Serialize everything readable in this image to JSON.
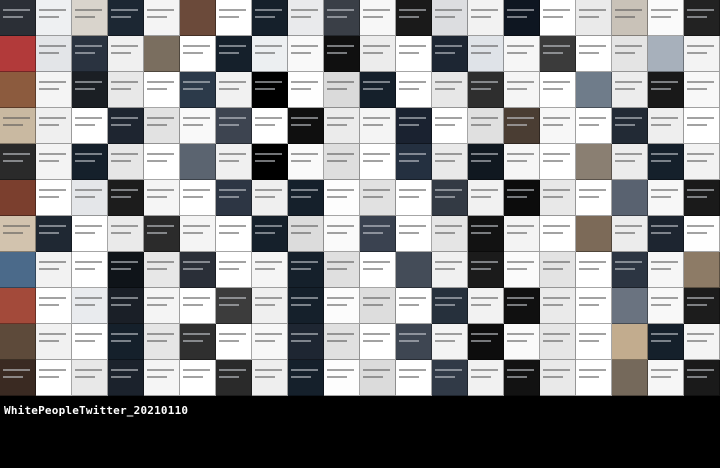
{
  "caption": "WhitePeopleTwitter_20210110",
  "tile_colors": [
    "#2b2f36",
    "#eef0f2",
    "#d9d4cc",
    "#1c2733",
    "#f4f4f4",
    "#6b4a3a",
    "#ffffff",
    "#15202b",
    "#e9eaec",
    "#3a3f47",
    "#f7f7f7",
    "#1a1a1a",
    "#dcdde0",
    "#f2f2f2",
    "#0e1621",
    "#ffffff",
    "#eaeaea",
    "#c9c2b8",
    "#fafafa",
    "#222",
    "#b23a3a",
    "#e3e5e8",
    "#2a3340",
    "#f0f0f0",
    "#7a6e5f",
    "#ffffff",
    "#15202b",
    "#eceff1",
    "#f9f9f9",
    "#101010",
    "#ececec",
    "#ffffff",
    "#1d2633",
    "#dfe3e8",
    "#f6f6f6",
    "#3b3b3b",
    "#ffffff",
    "#e4e4e4",
    "#a7b0bb",
    "#f3f3f3",
    "#8c5b3e",
    "#f4f4f4",
    "#1b1f24",
    "#e8e8e8",
    "#ffffff",
    "#2c3a4a",
    "#f1f1f1",
    "#000000",
    "#fefefe",
    "#dadada",
    "#15202b",
    "#ffffff",
    "#e7e7e7",
    "#2e2e2e",
    "#f5f5f5",
    "#ffffff",
    "#6f7c8a",
    "#ececec",
    "#191919",
    "#f8f8f8",
    "#c9b9a1",
    "#efefef",
    "#ffffff",
    "#1e2530",
    "#e2e2e2",
    "#f9f9f9",
    "#3d4450",
    "#ffffff",
    "#0f0f0f",
    "#ebebeb",
    "#f4f4f4",
    "#1a2230",
    "#ffffff",
    "#e0e0e0",
    "#4a3d33",
    "#f7f7f7",
    "#ffffff",
    "#222a35",
    "#eeeeee",
    "#ffffff",
    "#2a2a2a",
    "#f3f3f3",
    "#15202b",
    "#e6e6e6",
    "#ffffff",
    "#5b6470",
    "#f0f0f0",
    "#000000",
    "#fafafa",
    "#dedede",
    "#ffffff",
    "#243040",
    "#e9e9e9",
    "#101820",
    "#f6f6f6",
    "#ffffff",
    "#8a7f72",
    "#ececec",
    "#15202b",
    "#f2f2f2",
    "#7b3f2e",
    "#ffffff",
    "#e4e6e9",
    "#1c1c1c",
    "#f5f5f5",
    "#ffffff",
    "#2d3644",
    "#efefef",
    "#15202b",
    "#fdfdfd",
    "#e1e1e1",
    "#ffffff",
    "#333a44",
    "#f1f1f1",
    "#0c0c0c",
    "#e8e8e8",
    "#ffffff",
    "#596270",
    "#f7f7f7",
    "#1a1a1a",
    "#d2c3ae",
    "#1f2833",
    "#ffffff",
    "#eaeaea",
    "#2b2b2b",
    "#f4f4f4",
    "#ffffff",
    "#15202b",
    "#dcdcdc",
    "#fafafa",
    "#3a4250",
    "#ffffff",
    "#e5e5e5",
    "#121212",
    "#f3f3f3",
    "#ffffff",
    "#7c6a58",
    "#ececec",
    "#1d2530",
    "#fefefe",
    "#4b6a8a",
    "#f2f2f2",
    "#ffffff",
    "#0f1419",
    "#e7e7e7",
    "#2a2f38",
    "#ffffff",
    "#f5f5f5",
    "#15202b",
    "#dfdfdf",
    "#ffffff",
    "#444c58",
    "#f0f0f0",
    "#1b1b1b",
    "#fbfbfb",
    "#e3e3e3",
    "#ffffff",
    "#2c3542",
    "#f6f6f6",
    "#8d7b66",
    "#a34a3a",
    "#ffffff",
    "#e9ebee",
    "#1a1f27",
    "#f4f4f4",
    "#ffffff",
    "#3c3c3c",
    "#efefef",
    "#15202b",
    "#fcfcfc",
    "#dddddd",
    "#ffffff",
    "#26303c",
    "#f2f2f2",
    "#101010",
    "#eaeaea",
    "#ffffff",
    "#6a7380",
    "#f8f8f8",
    "#1c1c1c",
    "#5d4a3a",
    "#f1f1f1",
    "#ffffff",
    "#15202b",
    "#e5e5e5",
    "#2f2f2f",
    "#ffffff",
    "#f7f7f7",
    "#1e2632",
    "#e0e0e0",
    "#ffffff",
    "#3e4652",
    "#f3f3f3",
    "#0d0d0d",
    "#fafafa",
    "#e6e6e6",
    "#ffffff",
    "#c2ac8e",
    "#15202b",
    "#f4f4f4",
    "#3a2a22",
    "#ffffff",
    "#e8e8e8",
    "#1b222c",
    "#f5f5f5",
    "#ffffff",
    "#2a2a2a",
    "#eeeeee",
    "#15202b",
    "#fdfdfd",
    "#dbdbdb",
    "#ffffff",
    "#313a47",
    "#f1f1f1",
    "#121212",
    "#e9e9e9",
    "#ffffff",
    "#75695b",
    "#f6f6f6",
    "#1a1a1a"
  ]
}
